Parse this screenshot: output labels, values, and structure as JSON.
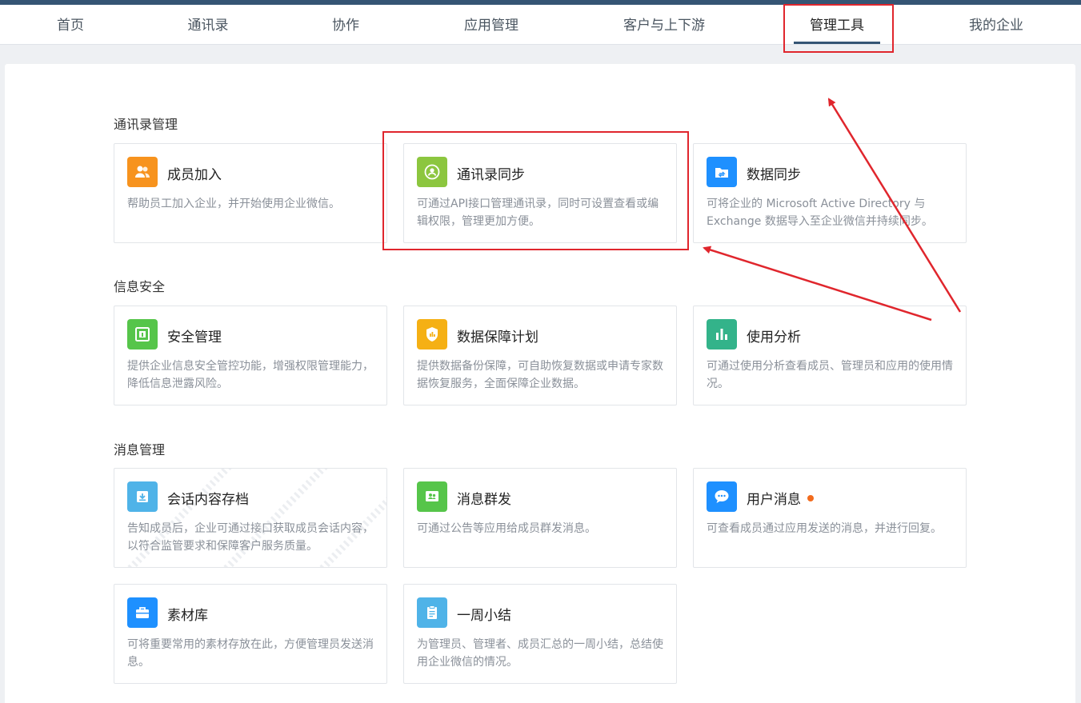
{
  "nav": {
    "items": [
      {
        "label": "首页"
      },
      {
        "label": "通讯录"
      },
      {
        "label": "协作"
      },
      {
        "label": "应用管理"
      },
      {
        "label": "客户与上下游"
      },
      {
        "label": "管理工具",
        "active": true
      },
      {
        "label": "我的企业"
      }
    ]
  },
  "sections": [
    {
      "title": "通讯录管理",
      "cards": [
        {
          "title": "成员加入",
          "desc": "帮助员工加入企业，并开始使用企业微信。",
          "icon": "members-icon",
          "color": "#f7931e"
        },
        {
          "title": "通讯录同步",
          "desc": "可通过API接口管理通讯录，同时可设置查看或编辑权限，管理更加方便。",
          "icon": "sync-contacts-icon",
          "color": "#8cc63f"
        },
        {
          "title": "数据同步",
          "desc": "可将企业的 Microsoft Active Directory 与 Exchange 数据导入至企业微信并持续同步。",
          "icon": "folder-sync-icon",
          "color": "#1e90ff"
        }
      ]
    },
    {
      "title": "信息安全",
      "cards": [
        {
          "title": "安全管理",
          "desc": "提供企业信息安全管控功能，增强权限管理能力，降低信息泄露风险。",
          "icon": "safe-icon",
          "color": "#56c54a"
        },
        {
          "title": "数据保障计划",
          "desc": "提供数据备份保障，可自助恢复数据或申请专家数据恢复服务，全面保障企业数据。",
          "icon": "shield-icon",
          "color": "#f5b014"
        },
        {
          "title": "使用分析",
          "desc": "可通过使用分析查看成员、管理员和应用的使用情况。",
          "icon": "bar-chart-icon",
          "color": "#33b38a"
        }
      ]
    },
    {
      "title": "消息管理",
      "cards": [
        {
          "title": "会话内容存档",
          "desc": "告知成员后，企业可通过接口获取成员会话内容，以符合监管要求和保障客户服务质量。",
          "icon": "archive-icon",
          "color": "#4fb3e8"
        },
        {
          "title": "消息群发",
          "desc": "可通过公告等应用给成员群发消息。",
          "icon": "broadcast-icon",
          "color": "#56c54a"
        },
        {
          "title": "用户消息",
          "desc": "可查看成员通过应用发送的消息，并进行回复。",
          "icon": "chat-bubble-icon",
          "color": "#1e90ff",
          "badge": true
        },
        {
          "title": "素材库",
          "desc": "可将重要常用的素材存放在此，方便管理员发送消息。",
          "icon": "briefcase-icon",
          "color": "#1e90ff"
        },
        {
          "title": "一周小结",
          "desc": "为管理员、管理者、成员汇总的一周小结，总结使用企业微信的情况。",
          "icon": "clipboard-icon",
          "color": "#4fb3e8"
        }
      ]
    }
  ],
  "annotation_color": "#e0262d"
}
